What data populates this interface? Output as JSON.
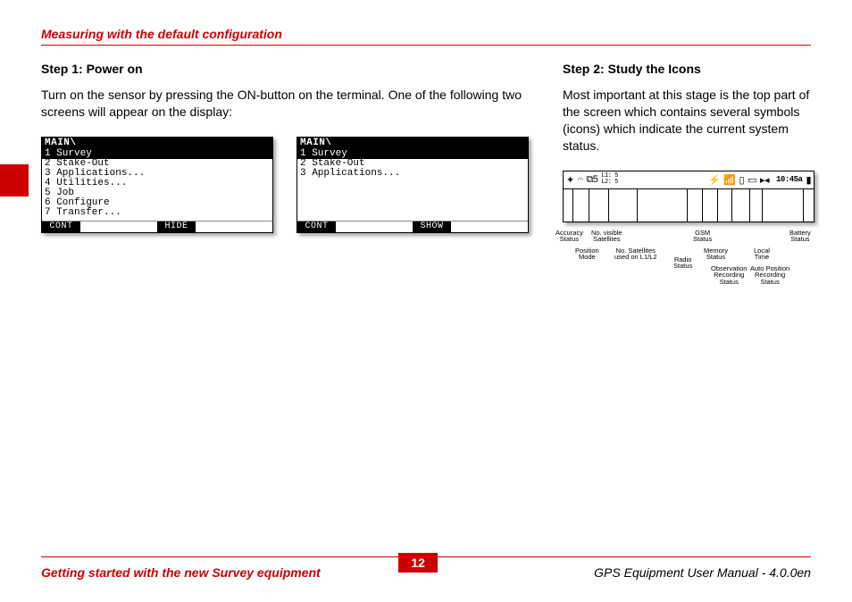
{
  "header": {
    "section_title": "Measuring with the default configuration"
  },
  "step1": {
    "heading": "Step 1: Power on",
    "body": "Turn on the sensor by pressing the ON-button on the terminal. One of the following two screens will appear on the display:"
  },
  "step2": {
    "heading": "Step 2: Study the Icons",
    "body": "Most important at this stage is the top part of the screen which contains several symbols (icons) which indicate the current system status."
  },
  "lcd1": {
    "title": "MAIN\\",
    "lines": [
      "1 Survey",
      "2 Stake-Out",
      "3 Applications...",
      "4 Utilities...",
      "5 Job",
      "6 Configure",
      "7 Transfer..."
    ],
    "footer": [
      "CONT",
      "",
      "",
      "HIDE",
      "",
      ""
    ]
  },
  "lcd2": {
    "title": "MAIN\\",
    "lines": [
      "1 Survey",
      "2 Stake-Out",
      "3 Applications..."
    ],
    "footer": [
      "CONT",
      "",
      "",
      "SHOW",
      "",
      ""
    ]
  },
  "iconbar": {
    "l1": "L1: 5",
    "l2": "L2: 5",
    "time": "10:45a",
    "labels": {
      "accuracy": "Accuracy\nStatus",
      "position": "Position\nMode",
      "visible": "No. visible\nSatellites",
      "used": "No. Satellites\nused on L1/L2",
      "radio": "Radio\nStatus",
      "gsm": "GSM\nStatus",
      "memory": "Memory\nStatus",
      "obs": "Observation\nRecording\nStatus",
      "local": "Local\nTime",
      "autopos": "Auto Position\nRecording\nStatus",
      "battery": "Battery\nStatus"
    }
  },
  "footer": {
    "left": "Getting started with the new Survey equipment",
    "page": "12",
    "right": "GPS Equipment User Manual - 4.0.0en"
  }
}
